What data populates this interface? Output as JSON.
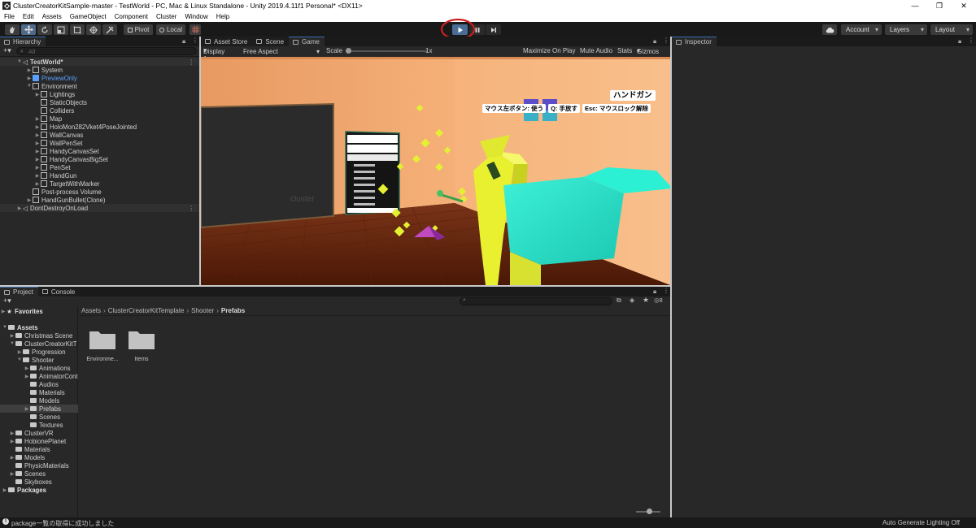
{
  "window": {
    "title": "ClusterCreatorKitSample-master - TestWorld - PC, Mac & Linux Standalone - Unity 2019.4.11f1 Personal* <DX11>",
    "minimize": "—",
    "restore": "❐",
    "close": "✕"
  },
  "menu": [
    "File",
    "Edit",
    "Assets",
    "GameObject",
    "Component",
    "Cluster",
    "Window",
    "Help"
  ],
  "toolbar": {
    "pivot": "Pivot",
    "local": "Local",
    "account": "Account",
    "layers": "Layers",
    "layout": "Layout"
  },
  "hierarchy": {
    "tab": "Hierarchy",
    "search_placeholder": "All",
    "scene": "TestWorld*",
    "items": [
      {
        "label": "System",
        "depth": 1,
        "arrow": true
      },
      {
        "label": "PreviewOnly",
        "depth": 1,
        "arrow": true,
        "highlight": true
      },
      {
        "label": "Environment",
        "depth": 1,
        "arrow": true,
        "open": true
      },
      {
        "label": "Lightings",
        "depth": 2,
        "arrow": true
      },
      {
        "label": "StaticObjects",
        "depth": 2,
        "arrow": false
      },
      {
        "label": "Colliders",
        "depth": 2,
        "arrow": false
      },
      {
        "label": "Map",
        "depth": 2,
        "arrow": true
      },
      {
        "label": "HoloMon282Vket4PoseJointed",
        "depth": 2,
        "arrow": true
      },
      {
        "label": "WallCanvas",
        "depth": 2,
        "arrow": true
      },
      {
        "label": "WallPenSet",
        "depth": 2,
        "arrow": true
      },
      {
        "label": "HandyCanvasSet",
        "depth": 2,
        "arrow": true
      },
      {
        "label": "HandyCanvasBigSet",
        "depth": 2,
        "arrow": true
      },
      {
        "label": "PenSet",
        "depth": 2,
        "arrow": true
      },
      {
        "label": "HandGun",
        "depth": 2,
        "arrow": true
      },
      {
        "label": "TargetWithMarker",
        "depth": 2,
        "arrow": true
      },
      {
        "label": "Post-process Volume",
        "depth": 1,
        "arrow": false
      },
      {
        "label": "HandGunBullet(Clone)",
        "depth": 1,
        "arrow": true
      }
    ],
    "dontdestroy": "DontDestroyOnLoad"
  },
  "game": {
    "tabs": [
      "Asset Store",
      "Scene",
      "Game"
    ],
    "display": "Display 1",
    "aspect": "Free Aspect",
    "scale_label": "Scale",
    "scale_value": "1x",
    "maximize": "Maximize On Play",
    "mute": "Mute Audio",
    "stats": "Stats",
    "gizmos": "Gizmos",
    "wall_logo": "cluster",
    "hud_title": "ハンドガン",
    "hud_hints": [
      "マウス左ボタン: 使う",
      "Q: 手放す",
      "Esc: マウスロック解除"
    ]
  },
  "inspector": {
    "tab": "Inspector"
  },
  "project": {
    "tabs": [
      "Project",
      "Console"
    ],
    "favorites": "Favorites",
    "tree": [
      {
        "label": "Assets",
        "depth": 0,
        "bold": true,
        "open": true
      },
      {
        "label": "Christmas Scene",
        "depth": 1,
        "arrow": true
      },
      {
        "label": "ClusterCreatorKitT",
        "depth": 1,
        "arrow": true,
        "open": true
      },
      {
        "label": "Progression",
        "depth": 2,
        "arrow": true
      },
      {
        "label": "Shooter",
        "depth": 2,
        "arrow": true,
        "open": true
      },
      {
        "label": "Animations",
        "depth": 3,
        "arrow": true
      },
      {
        "label": "AnimatorCont",
        "depth": 3,
        "arrow": true
      },
      {
        "label": "Audios",
        "depth": 3,
        "arrow": false
      },
      {
        "label": "Materials",
        "depth": 3,
        "arrow": false
      },
      {
        "label": "Models",
        "depth": 3,
        "arrow": false
      },
      {
        "label": "Prefabs",
        "depth": 3,
        "arrow": true,
        "selected": true
      },
      {
        "label": "Scenes",
        "depth": 3,
        "arrow": false
      },
      {
        "label": "Textures",
        "depth": 3,
        "arrow": false
      },
      {
        "label": "ClusterVR",
        "depth": 1,
        "arrow": true
      },
      {
        "label": "HobionePlanet",
        "depth": 1,
        "arrow": true
      },
      {
        "label": "Materials",
        "depth": 1,
        "arrow": false
      },
      {
        "label": "Models",
        "depth": 1,
        "arrow": true
      },
      {
        "label": "PhysicMaterials",
        "depth": 1,
        "arrow": false
      },
      {
        "label": "Scenes",
        "depth": 1,
        "arrow": true
      },
      {
        "label": "Skyboxes",
        "depth": 1,
        "arrow": false
      },
      {
        "label": "Packages",
        "depth": 0,
        "bold": true,
        "arrow": true
      }
    ],
    "breadcrumb": [
      "Assets",
      "ClusterCreatorKitTemplate",
      "Shooter",
      "Prefabs"
    ],
    "folders": [
      "Environme...",
      "Items"
    ],
    "hidden_count": "8"
  },
  "status": {
    "message": "package一覧の取得に成功しました",
    "right": "Auto Generate Lighting Off"
  },
  "colors": {
    "accent": "#3a6fb0",
    "annotation_circle": "#cc1f1f",
    "wall": "#f5b078",
    "floor": "#6a2a10",
    "gun_teal": "#2fe0c8",
    "gun_yellow": "#e8f030"
  }
}
